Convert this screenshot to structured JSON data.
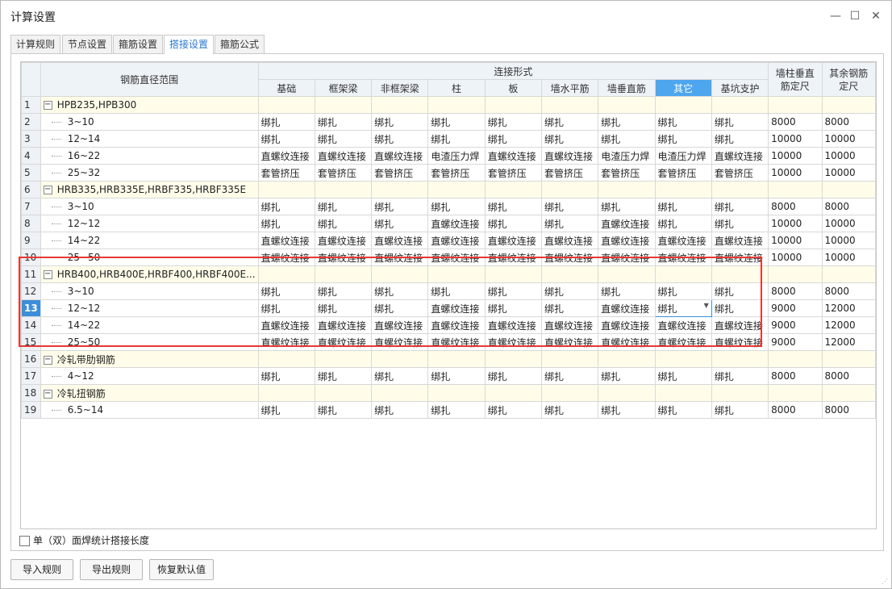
{
  "window": {
    "title": "计算设置",
    "min_label": "—",
    "max_label": "☐",
    "close_label": "✕"
  },
  "tabs": [
    {
      "label": "计算规则",
      "active": false
    },
    {
      "label": "节点设置",
      "active": false
    },
    {
      "label": "箍筋设置",
      "active": false
    },
    {
      "label": "搭接设置",
      "active": true
    },
    {
      "label": "箍筋公式",
      "active": false
    }
  ],
  "grid": {
    "col_range": "钢筋直径范围",
    "col_conn": "连接形式",
    "sub_headers": [
      "基础",
      "框架梁",
      "非框架梁",
      "柱",
      "板",
      "墙水平筋",
      "墙垂直筋",
      "其它",
      "基坑支护"
    ],
    "col_wall": "墙柱垂直筋定尺",
    "col_other": "其余钢筋定尺",
    "rows": [
      {
        "num": "1",
        "type": "group",
        "label": "HPB235,HPB300"
      },
      {
        "num": "2",
        "type": "item",
        "label": "3~10",
        "cells": [
          "绑扎",
          "绑扎",
          "绑扎",
          "绑扎",
          "绑扎",
          "绑扎",
          "绑扎",
          "绑扎",
          "绑扎"
        ],
        "wall": "8000",
        "other": "8000"
      },
      {
        "num": "3",
        "type": "item",
        "label": "12~14",
        "cells": [
          "绑扎",
          "绑扎",
          "绑扎",
          "绑扎",
          "绑扎",
          "绑扎",
          "绑扎",
          "绑扎",
          "绑扎"
        ],
        "wall": "10000",
        "other": "10000"
      },
      {
        "num": "4",
        "type": "item",
        "label": "16~22",
        "cells": [
          "直螺纹连接",
          "直螺纹连接",
          "直螺纹连接",
          "电渣压力焊",
          "直螺纹连接",
          "直螺纹连接",
          "电渣压力焊",
          "电渣压力焊",
          "直螺纹连接"
        ],
        "wall": "10000",
        "other": "10000"
      },
      {
        "num": "5",
        "type": "item",
        "label": "25~32",
        "cells": [
          "套管挤压",
          "套管挤压",
          "套管挤压",
          "套管挤压",
          "套管挤压",
          "套管挤压",
          "套管挤压",
          "套管挤压",
          "套管挤压"
        ],
        "wall": "10000",
        "other": "10000"
      },
      {
        "num": "6",
        "type": "group",
        "label": "HRB335,HRB335E,HRBF335,HRBF335E"
      },
      {
        "num": "7",
        "type": "item",
        "label": "3~10",
        "cells": [
          "绑扎",
          "绑扎",
          "绑扎",
          "绑扎",
          "绑扎",
          "绑扎",
          "绑扎",
          "绑扎",
          "绑扎"
        ],
        "wall": "8000",
        "other": "8000"
      },
      {
        "num": "8",
        "type": "item",
        "label": "12~12",
        "cells": [
          "绑扎",
          "绑扎",
          "绑扎",
          "直螺纹连接",
          "绑扎",
          "绑扎",
          "直螺纹连接",
          "绑扎",
          "绑扎"
        ],
        "wall": "10000",
        "other": "10000"
      },
      {
        "num": "9",
        "type": "item",
        "label": "14~22",
        "cells": [
          "直螺纹连接",
          "直螺纹连接",
          "直螺纹连接",
          "直螺纹连接",
          "直螺纹连接",
          "直螺纹连接",
          "直螺纹连接",
          "直螺纹连接",
          "直螺纹连接"
        ],
        "wall": "10000",
        "other": "10000"
      },
      {
        "num": "10",
        "type": "item",
        "label": "25~50",
        "cells": [
          "直螺纹连接",
          "直螺纹连接",
          "直螺纹连接",
          "直螺纹连接",
          "直螺纹连接",
          "直螺纹连接",
          "直螺纹连接",
          "直螺纹连接",
          "直螺纹连接"
        ],
        "wall": "10000",
        "other": "10000"
      },
      {
        "num": "11",
        "type": "group",
        "label": "HRB400,HRB400E,HRBF400,HRBF400E..."
      },
      {
        "num": "12",
        "type": "item",
        "label": "3~10",
        "cells": [
          "绑扎",
          "绑扎",
          "绑扎",
          "绑扎",
          "绑扎",
          "绑扎",
          "绑扎",
          "绑扎",
          "绑扎"
        ],
        "wall": "8000",
        "other": "8000"
      },
      {
        "num": "13",
        "type": "item",
        "label": "12~12",
        "selected": true,
        "cells": [
          "绑扎",
          "绑扎",
          "绑扎",
          "直螺纹连接",
          "绑扎",
          "绑扎",
          "直螺纹连接",
          "绑扎",
          "绑扎"
        ],
        "wall": "9000",
        "other": "12000"
      },
      {
        "num": "14",
        "type": "item",
        "label": "14~22",
        "cells": [
          "直螺纹连接",
          "直螺纹连接",
          "直螺纹连接",
          "直螺纹连接",
          "直螺纹连接",
          "直螺纹连接",
          "直螺纹连接",
          "直螺纹连接",
          "直螺纹连接"
        ],
        "wall": "9000",
        "other": "12000"
      },
      {
        "num": "15",
        "type": "item",
        "label": "25~50",
        "cells": [
          "直螺纹连接",
          "直螺纹连接",
          "直螺纹连接",
          "直螺纹连接",
          "直螺纹连接",
          "直螺纹连接",
          "直螺纹连接",
          "直螺纹连接",
          "直螺纹连接"
        ],
        "wall": "9000",
        "other": "12000"
      },
      {
        "num": "16",
        "type": "group",
        "label": "冷轧带肋钢筋"
      },
      {
        "num": "17",
        "type": "item",
        "label": "4~12",
        "cells": [
          "绑扎",
          "绑扎",
          "绑扎",
          "绑扎",
          "绑扎",
          "绑扎",
          "绑扎",
          "绑扎",
          "绑扎"
        ],
        "wall": "8000",
        "other": "8000"
      },
      {
        "num": "18",
        "type": "group",
        "label": "冷轧扭钢筋"
      },
      {
        "num": "19",
        "type": "item",
        "label": "6.5~14",
        "cells": [
          "绑扎",
          "绑扎",
          "绑扎",
          "绑扎",
          "绑扎",
          "绑扎",
          "绑扎",
          "绑扎",
          "绑扎"
        ],
        "wall": "8000",
        "other": "8000"
      }
    ]
  },
  "checkbox_label": "单（双）面焊统计搭接长度",
  "buttons": {
    "import": "导入规则",
    "export": "导出规则",
    "restore": "恢复默认值"
  },
  "colors": {
    "accent": "#4da6ee",
    "highlight_box": "#e53935",
    "group_row_bg": "#fffde9"
  }
}
